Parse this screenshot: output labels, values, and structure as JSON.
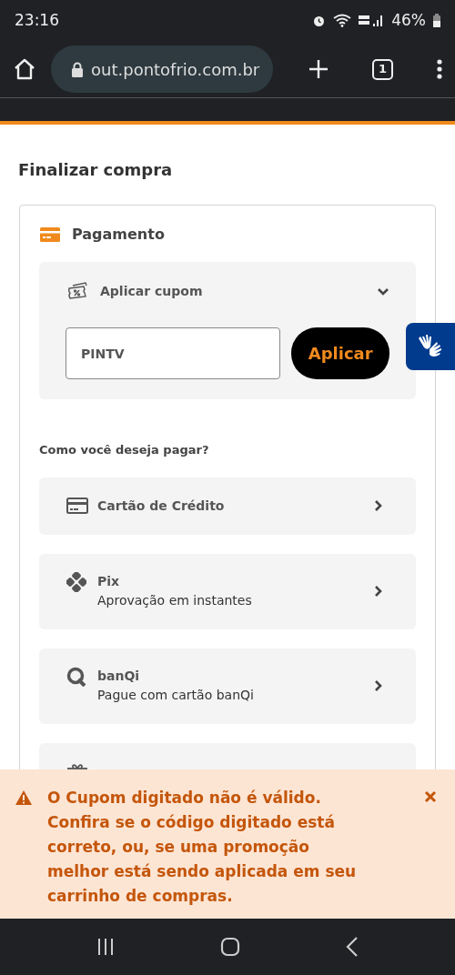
{
  "status_bar": {
    "time": "23:16",
    "battery": "46%"
  },
  "browser": {
    "url": "out.pontofrio.com.br",
    "tab_count": "1"
  },
  "page_title": "Finalizar compra",
  "payment": {
    "title": "Pagamento",
    "coupon": {
      "title": "Aplicar cupom",
      "expanded": true,
      "value": "PINTV",
      "button": "Aplicar"
    },
    "question": "Como você deseja pagar?",
    "methods": [
      {
        "kind": "card",
        "title": "Cartão de Crédito"
      },
      {
        "kind": "pix",
        "title": "Pix",
        "subtitle": "Aprovação em instantes"
      },
      {
        "kind": "banqi",
        "title": "banQi",
        "subtitle": "Pague com cartão banQi"
      },
      {
        "kind": "gift"
      }
    ]
  },
  "toast": {
    "kind": "warning",
    "message": "O Cupom digitado não é válido. Confira se o código digitado está correto, ou, se uma promoção melhor está sendo aplicada em seu carrinho de compras."
  }
}
